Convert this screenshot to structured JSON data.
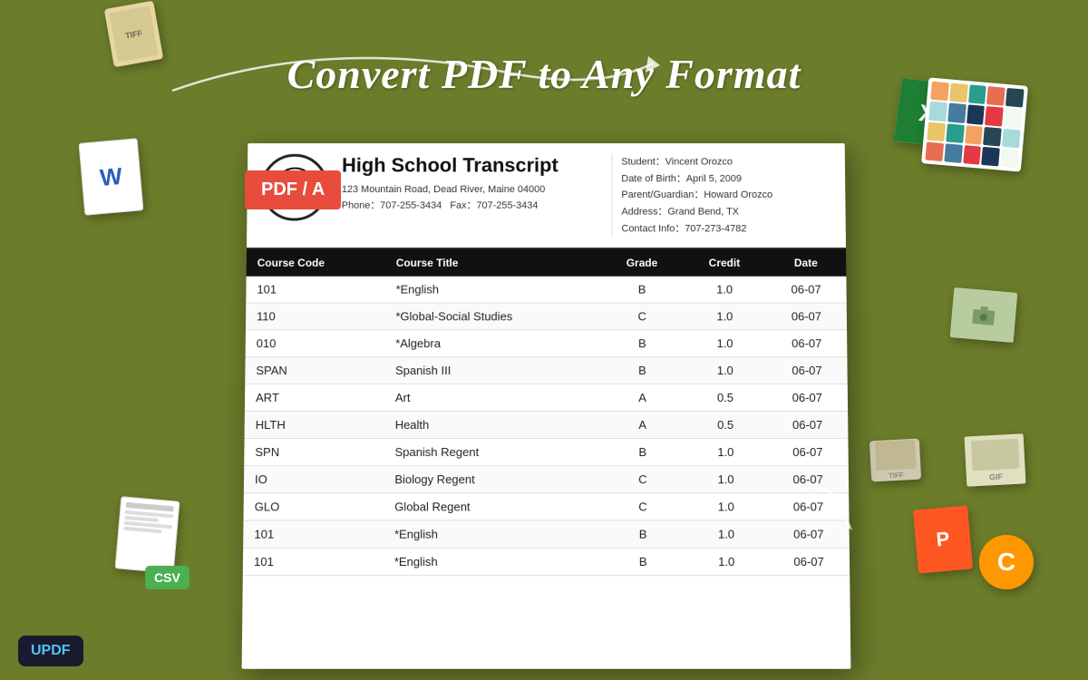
{
  "heading": "Convert PDF to Any Format",
  "pdf_badge": "PDF / A",
  "updf": {
    "label": "UPDF"
  },
  "document": {
    "title": "High School Transcript",
    "address": "123 Mountain Road, Dead River, Maine 04000",
    "phone": "Phone：707-255-3434",
    "fax": "Fax：707-255-3434",
    "student": "Student：Vincent Orozco",
    "dob": "Date of Birth：April 5,  2009",
    "parent": "Parent/Guardian：Howard Orozco",
    "address_info": "Address：Grand Bend, TX",
    "contact": "Contact Info：707-273-4782"
  },
  "table": {
    "headers": [
      "Course Code",
      "Course Title",
      "Grade",
      "Credit",
      "Date"
    ],
    "rows": [
      {
        "code": "101",
        "title": "*English",
        "grade": "B",
        "credit": "1.0",
        "date": "06-07"
      },
      {
        "code": "110",
        "title": "*Global-Social Studies",
        "grade": "C",
        "credit": "1.0",
        "date": "06-07"
      },
      {
        "code": "010",
        "title": "*Algebra",
        "grade": "B",
        "credit": "1.0",
        "date": "06-07"
      },
      {
        "code": "SPAN",
        "title": "Spanish III",
        "grade": "B",
        "credit": "1.0",
        "date": "06-07"
      },
      {
        "code": "ART",
        "title": "Art",
        "grade": "A",
        "credit": "0.5",
        "date": "06-07"
      },
      {
        "code": "HLTH",
        "title": "Health",
        "grade": "A",
        "credit": "0.5",
        "date": "06-07"
      },
      {
        "code": "SPN",
        "title": "Spanish Regent",
        "grade": "B",
        "credit": "1.0",
        "date": "06-07"
      },
      {
        "code": "IO",
        "title": "Biology Regent",
        "grade": "C",
        "credit": "1.0",
        "date": "06-07"
      },
      {
        "code": "GLO",
        "title": "Global Regent",
        "grade": "C",
        "credit": "1.0",
        "date": "06-07"
      },
      {
        "code": "101",
        "title": "*English",
        "grade": "B",
        "credit": "1.0",
        "date": "06-07"
      },
      {
        "code": "101",
        "title": "*English",
        "grade": "B",
        "credit": "1.0",
        "date": "06-07"
      }
    ]
  },
  "floating_icons": {
    "tiff_label": "TIFF",
    "word_label": "W",
    "csv_label": "CSV",
    "excel_label": "X",
    "ppt_label": "P",
    "gif_label": "GIF",
    "c_label": "C"
  },
  "grid_colors": [
    "#f4a261",
    "#e9c46a",
    "#2a9d8f",
    "#e76f51",
    "#264653",
    "#a8dadc",
    "#457b9d",
    "#1d3557",
    "#e63946",
    "#f1faee",
    "#e9c46a",
    "#2a9d8f",
    "#f4a261",
    "#264653",
    "#a8dadc",
    "#e76f51",
    "#457b9d",
    "#e63946",
    "#1d3557",
    "#f1faee"
  ]
}
